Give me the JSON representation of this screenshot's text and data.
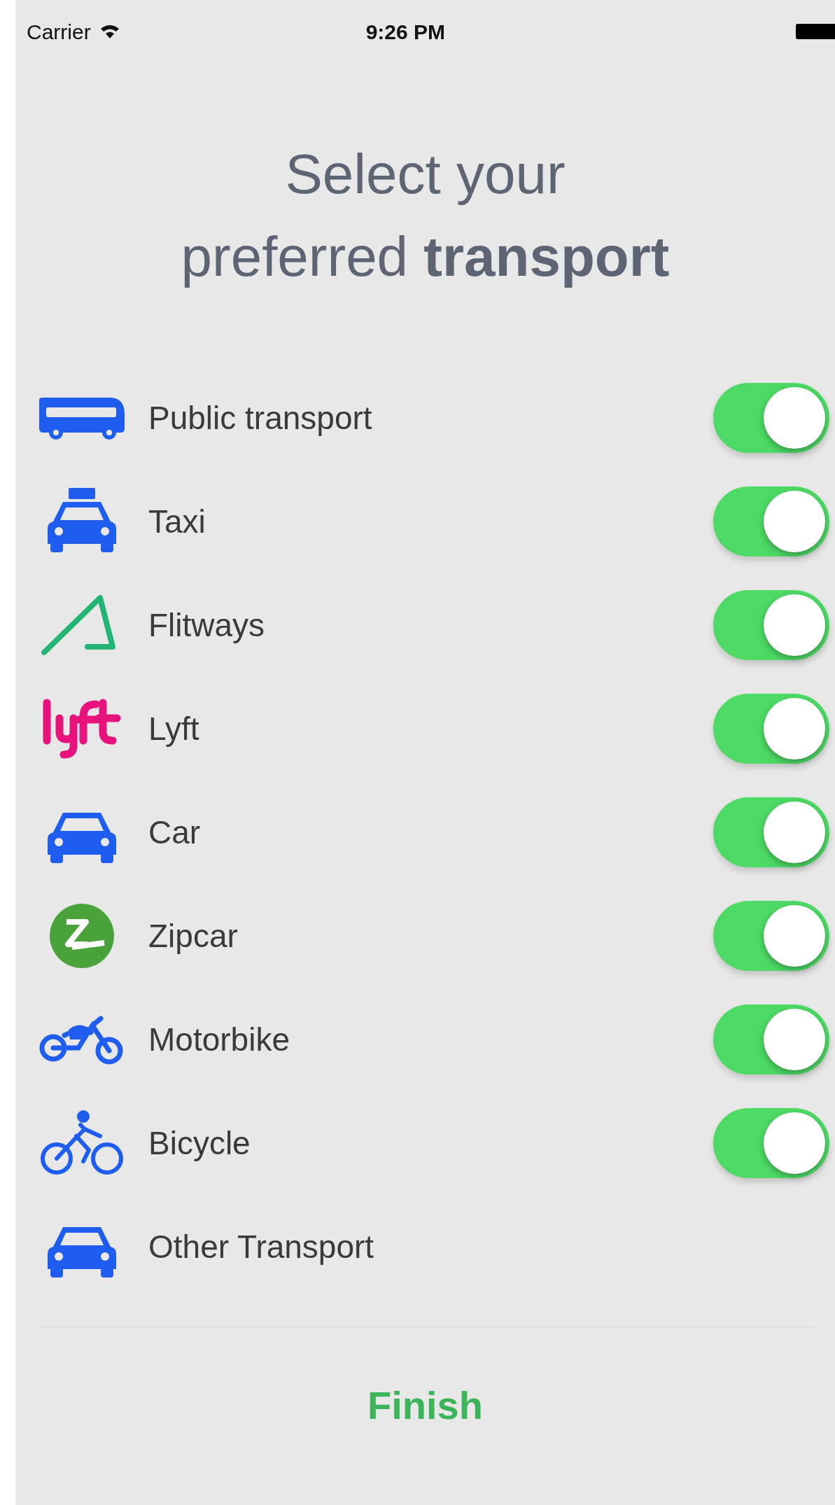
{
  "status_bar": {
    "carrier": "Carrier",
    "time": "9:26 PM"
  },
  "title": {
    "line_1": "Select your",
    "line_2": "preferred **transport**"
  },
  "options": [
    {
      "label": "Public transport",
      "kind": "switch",
      "on": true
    },
    {
      "label": "Taxi",
      "kind": "switch",
      "on": true
    },
    {
      "label": "Flitways",
      "kind": "switch",
      "on": true
    },
    {
      "label": "Lyft",
      "kind": "switch",
      "on": true
    },
    {
      "label": "Car",
      "kind": "switch",
      "on": true
    },
    {
      "label": "Zipcar",
      "kind": "switch",
      "on": true
    },
    {
      "label": "Motorbike",
      "kind": "switch",
      "on": true
    },
    {
      "label": "Bicycle",
      "kind": "switch",
      "on": true
    },
    {
      "label": "Other Transport",
      "kind": "plain"
    }
  ],
  "finish_button": "Finish"
}
